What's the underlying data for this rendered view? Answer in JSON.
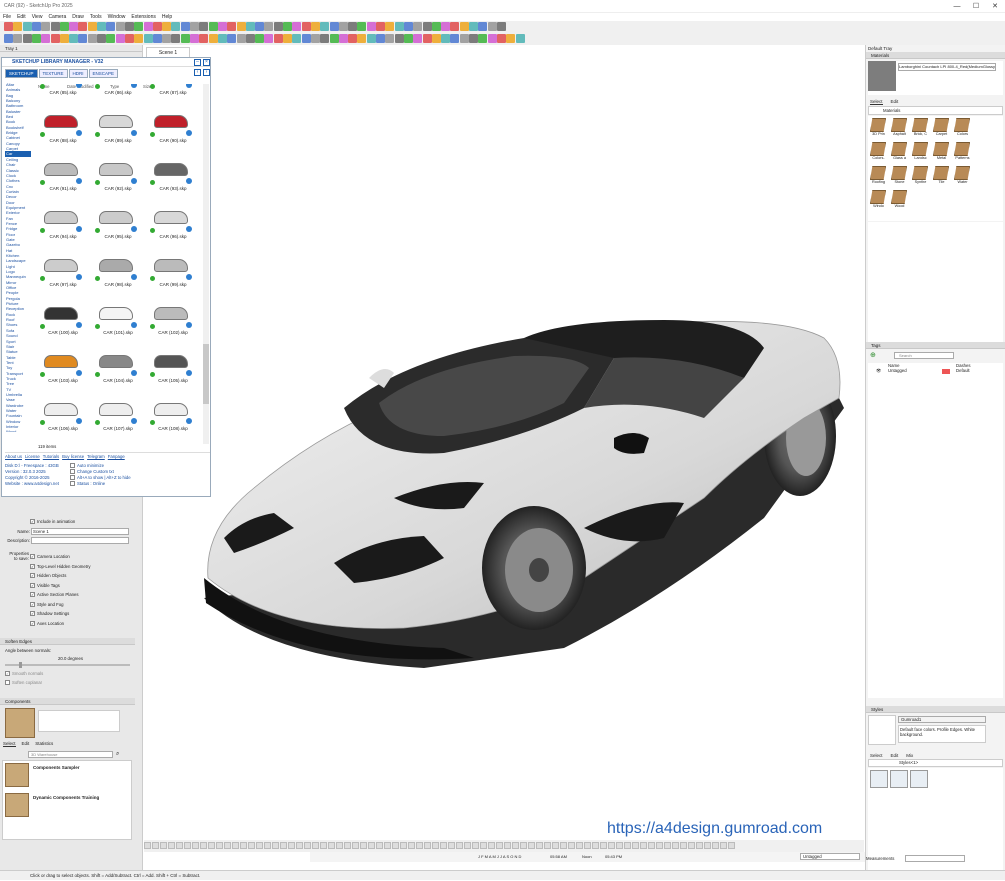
{
  "window": {
    "title": "CAR (92) - SketchUp Pro 2025",
    "min": "—",
    "max": "☐",
    "close": "✕"
  },
  "menu": [
    "File",
    "Edit",
    "View",
    "Camera",
    "Draw",
    "Tools",
    "Window",
    "Extensions",
    "Help"
  ],
  "left_tray": {
    "title": "Tray 1",
    "scene_tab": "Scene 1",
    "library": {
      "title": "SKETCHUP LIBRARY MANAGER - V32",
      "tabs": [
        "SKETCHUP",
        "TEXTURE",
        "HDRI",
        "ENSCAPE"
      ],
      "columns": [
        "Name",
        "Date modified",
        "Type",
        "Size"
      ],
      "categories": [
        "Altar",
        "Animals",
        "Bag",
        "Balcony",
        "Bathroom",
        "Baluster",
        "Bed",
        "Book",
        "Bookshelf",
        "Bridge",
        "Cabinet",
        "Canopy",
        "Carpet",
        "Car",
        "Ceiling",
        "Chair",
        "Classic",
        "Clock",
        "Clothes",
        "Cnc",
        "Curtain",
        "Decor",
        "Door",
        "Equipment",
        "Exterior",
        "Fan",
        "Fence",
        "Fridge",
        "Floor",
        "Gate",
        "Gazebo",
        "Hat",
        "Kitchen",
        "Landscape",
        "Light",
        "Logo",
        "Mannequin",
        "Mirror",
        "Office",
        "People",
        "Pergola",
        "Picture",
        "Reception",
        "Rock",
        "Roof",
        "Shoes",
        "Sofa",
        "Sound",
        "Sport",
        "Stair",
        "Statue",
        "Table",
        "Tent",
        "Toy",
        "Transport",
        "Truck",
        "Tree",
        "TV",
        "Umbrella",
        "Vase",
        "Wardrobe",
        "Water Fountain",
        "Window",
        "Interior",
        "Wood"
      ],
      "items": [
        "CAR (85).skp",
        "CAR (86).skp",
        "CAR (87).skp",
        "CAR (88).skp",
        "CAR (89).skp",
        "CAR (90).skp",
        "CAR (91).skp",
        "CAR (92).skp",
        "CAR (93).skp",
        "CAR (94).skp",
        "CAR (95).skp",
        "CAR (96).skp",
        "CAR (97).skp",
        "CAR (98).skp",
        "CAR (99).skp",
        "CAR (100).skp",
        "CAR (101).skp",
        "CAR (102).skp",
        "CAR (103).skp",
        "CAR (104).skp",
        "CAR (105).skp",
        "CAR (106).skp",
        "CAR (107).skp",
        "CAR (108).skp"
      ],
      "item_colors": [
        "#ffffff",
        "#ffffff",
        "#ffffff",
        "#c0202a",
        "#d8d8d8",
        "#c0202a",
        "#bbbbbb",
        "#c8c8c8",
        "#666666",
        "#cccccc",
        "#cccccc",
        "#d8d8d8",
        "#cccccc",
        "#aaaaaa",
        "#bbbbbb",
        "#333333",
        "#f4f4f4",
        "#bbbbbb",
        "#e08a20",
        "#888888",
        "#555555",
        "#eeeeee",
        "#eeeeee",
        "#eeeeee"
      ],
      "count": "119 items",
      "footer_links": [
        "About us",
        "License",
        "Tutorials",
        "Buy license",
        "Telegram",
        "Fanpage"
      ],
      "disk": "Disk D:\\ - Freespace : 43GB",
      "version": "Version : 32.0.3 2025",
      "copyright": "Copyright © 2016-2025",
      "website": "Website : www.a4design.net",
      "options": [
        "Auto minimize",
        "Change Custom txt",
        "Alt+A to show | Alt+Z to hide",
        "Status : Online"
      ]
    },
    "scenes": {
      "include_anim": "Include in animation",
      "name_label": "Name:",
      "name_value": "Scene 1",
      "desc_label": "Description:",
      "props_label": "Properties to save:",
      "props": [
        "Camera Location",
        "Top-Level Hidden Geometry",
        "Hidden Objects",
        "Visible Tags",
        "Active Section Planes",
        "Style and Fog",
        "Shadow Settings",
        "Axes Location"
      ]
    },
    "soften": {
      "title": "Soften Edges",
      "angle_label": "Angle between normals:",
      "angle_value": "20.0  degrees",
      "smooth": "Smooth normals",
      "coplanar": "Soften coplanar"
    },
    "components": {
      "title": "Components",
      "tabs": [
        "Select",
        "Edit",
        "Statistics"
      ],
      "search_placeholder": "3D Warehouse",
      "items": [
        "Components Sampler",
        "Dynamic Components Training"
      ]
    }
  },
  "right_tray": {
    "title": "Default Tray",
    "materials": {
      "title": "Materials",
      "current": "Lamborghini Countach LPI 800-4_Red(MediumGlossy)",
      "tabs": [
        "Select",
        "Edit"
      ],
      "collection": "Materials",
      "items": [
        "3D Prin",
        "Asphalt",
        "Brick, C",
        "Carpet",
        "Colors",
        "Colors-",
        "Glass a",
        "Landsc",
        "Metal",
        "Patterns",
        "Roofing",
        "Stone",
        "Synthe",
        "Tile",
        "Water",
        "Windo",
        "Wood"
      ]
    },
    "tags": {
      "title": "Tags",
      "search_placeholder": "Search",
      "columns": [
        "Name",
        "Dashes"
      ],
      "rows": [
        {
          "name": "Untagged",
          "dash": "Default"
        }
      ]
    },
    "styles": {
      "title": "Styles",
      "name": "Gumroad1",
      "desc": "Default face colors. Profile Edges. White background.",
      "tabs": [
        "Select",
        "Edit",
        "Mix"
      ],
      "collection": "Styles<1>"
    }
  },
  "bottom": {
    "tag": "Untagged",
    "measure_label": "Measurements",
    "months": "J F M A M J J A S O N D",
    "time1": "05:58 AM",
    "noon": "Noon",
    "time2": "05:43 PM"
  },
  "status": "Click or drag to select objects. Shift = Add/Subtract. Ctrl = Add. Shift + Ctrl = Subtract.",
  "watermark": "https://a4design.gumroad.com"
}
